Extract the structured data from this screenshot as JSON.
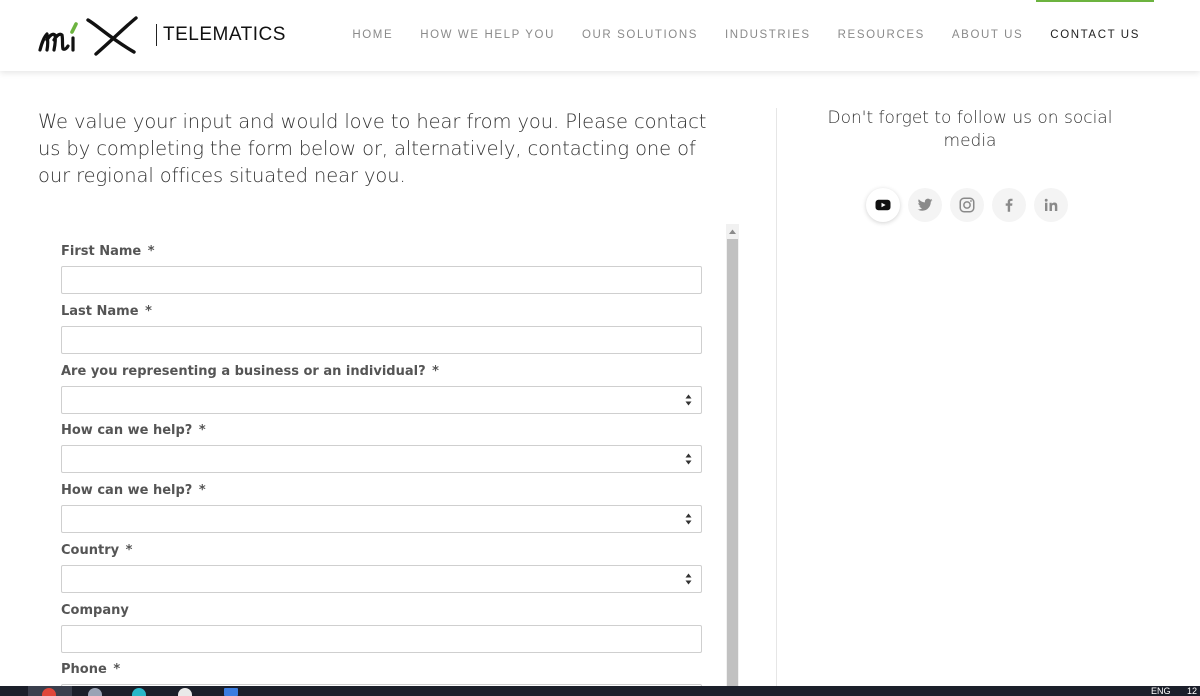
{
  "brand": {
    "logo_text": "TELEMATICS",
    "logo_mark_text": "MiX",
    "accent_color": "#6cb33f"
  },
  "nav": {
    "items": [
      {
        "label": "HOME",
        "active": false
      },
      {
        "label": "HOW WE HELP YOU",
        "active": false
      },
      {
        "label": "OUR SOLUTIONS",
        "active": false
      },
      {
        "label": "INDUSTRIES",
        "active": false
      },
      {
        "label": "RESOURCES",
        "active": false
      },
      {
        "label": "ABOUT US",
        "active": false
      },
      {
        "label": "CONTACT US",
        "active": true
      }
    ]
  },
  "intro": {
    "text": "We value your input and would love to hear from you. Please contact us by completing the form below or, alternatively, contacting one of our regional offices situated near you."
  },
  "social": {
    "title": "Don't forget to follow us on social media",
    "icons": [
      "youtube-icon",
      "twitter-icon",
      "instagram-icon",
      "facebook-icon",
      "linkedin-icon"
    ]
  },
  "form": {
    "fields": [
      {
        "label": "First Name",
        "required_mark": "*",
        "type": "text",
        "value": ""
      },
      {
        "label": "Last Name",
        "required_mark": "*",
        "type": "text",
        "value": ""
      },
      {
        "label": "Are you representing a business or an individual?",
        "required_mark": "*",
        "type": "select",
        "value": ""
      },
      {
        "label": "How can we help?",
        "required_mark": "*",
        "type": "select",
        "value": ""
      },
      {
        "label": "How can we help?",
        "required_mark": "*",
        "type": "select",
        "value": ""
      },
      {
        "label": "Country",
        "required_mark": "*",
        "type": "select",
        "value": ""
      },
      {
        "label": "Company",
        "required_mark": "",
        "type": "text",
        "value": ""
      },
      {
        "label": "Phone",
        "required_mark": "*",
        "type": "text",
        "value": ""
      }
    ]
  },
  "taskbar": {
    "language": "ENG",
    "clock_partial": "12"
  }
}
